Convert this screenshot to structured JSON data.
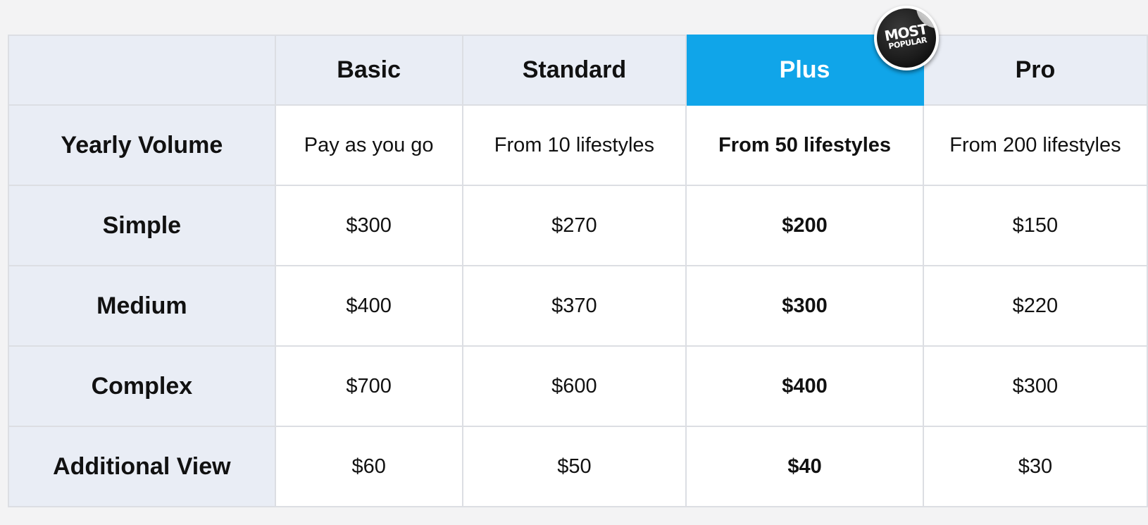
{
  "plans": [
    "Basic",
    "Standard",
    "Plus",
    "Pro"
  ],
  "highlight_plan": "Plus",
  "badge": {
    "line1": "MOST",
    "line2": "POPULAR"
  },
  "rows": [
    {
      "label": "Yearly Volume",
      "values": [
        "Pay as you go",
        "From 10 lifestyles",
        "From 50 lifestyles",
        "From 200 lifestyles"
      ]
    },
    {
      "label": "Simple",
      "values": [
        "$300",
        "$270",
        "$200",
        "$150"
      ]
    },
    {
      "label": "Medium",
      "values": [
        "$400",
        "$370",
        "$300",
        "$220"
      ]
    },
    {
      "label": "Complex",
      "values": [
        "$700",
        "$600",
        "$400",
        "$300"
      ]
    },
    {
      "label": "Additional View",
      "values": [
        "$60",
        "$50",
        "$40",
        "$30"
      ]
    }
  ],
  "colors": {
    "page_background": "#f3f3f4",
    "header_background": "#e9edf5",
    "highlight": "#10a5e9",
    "border": "#dcdee3"
  }
}
